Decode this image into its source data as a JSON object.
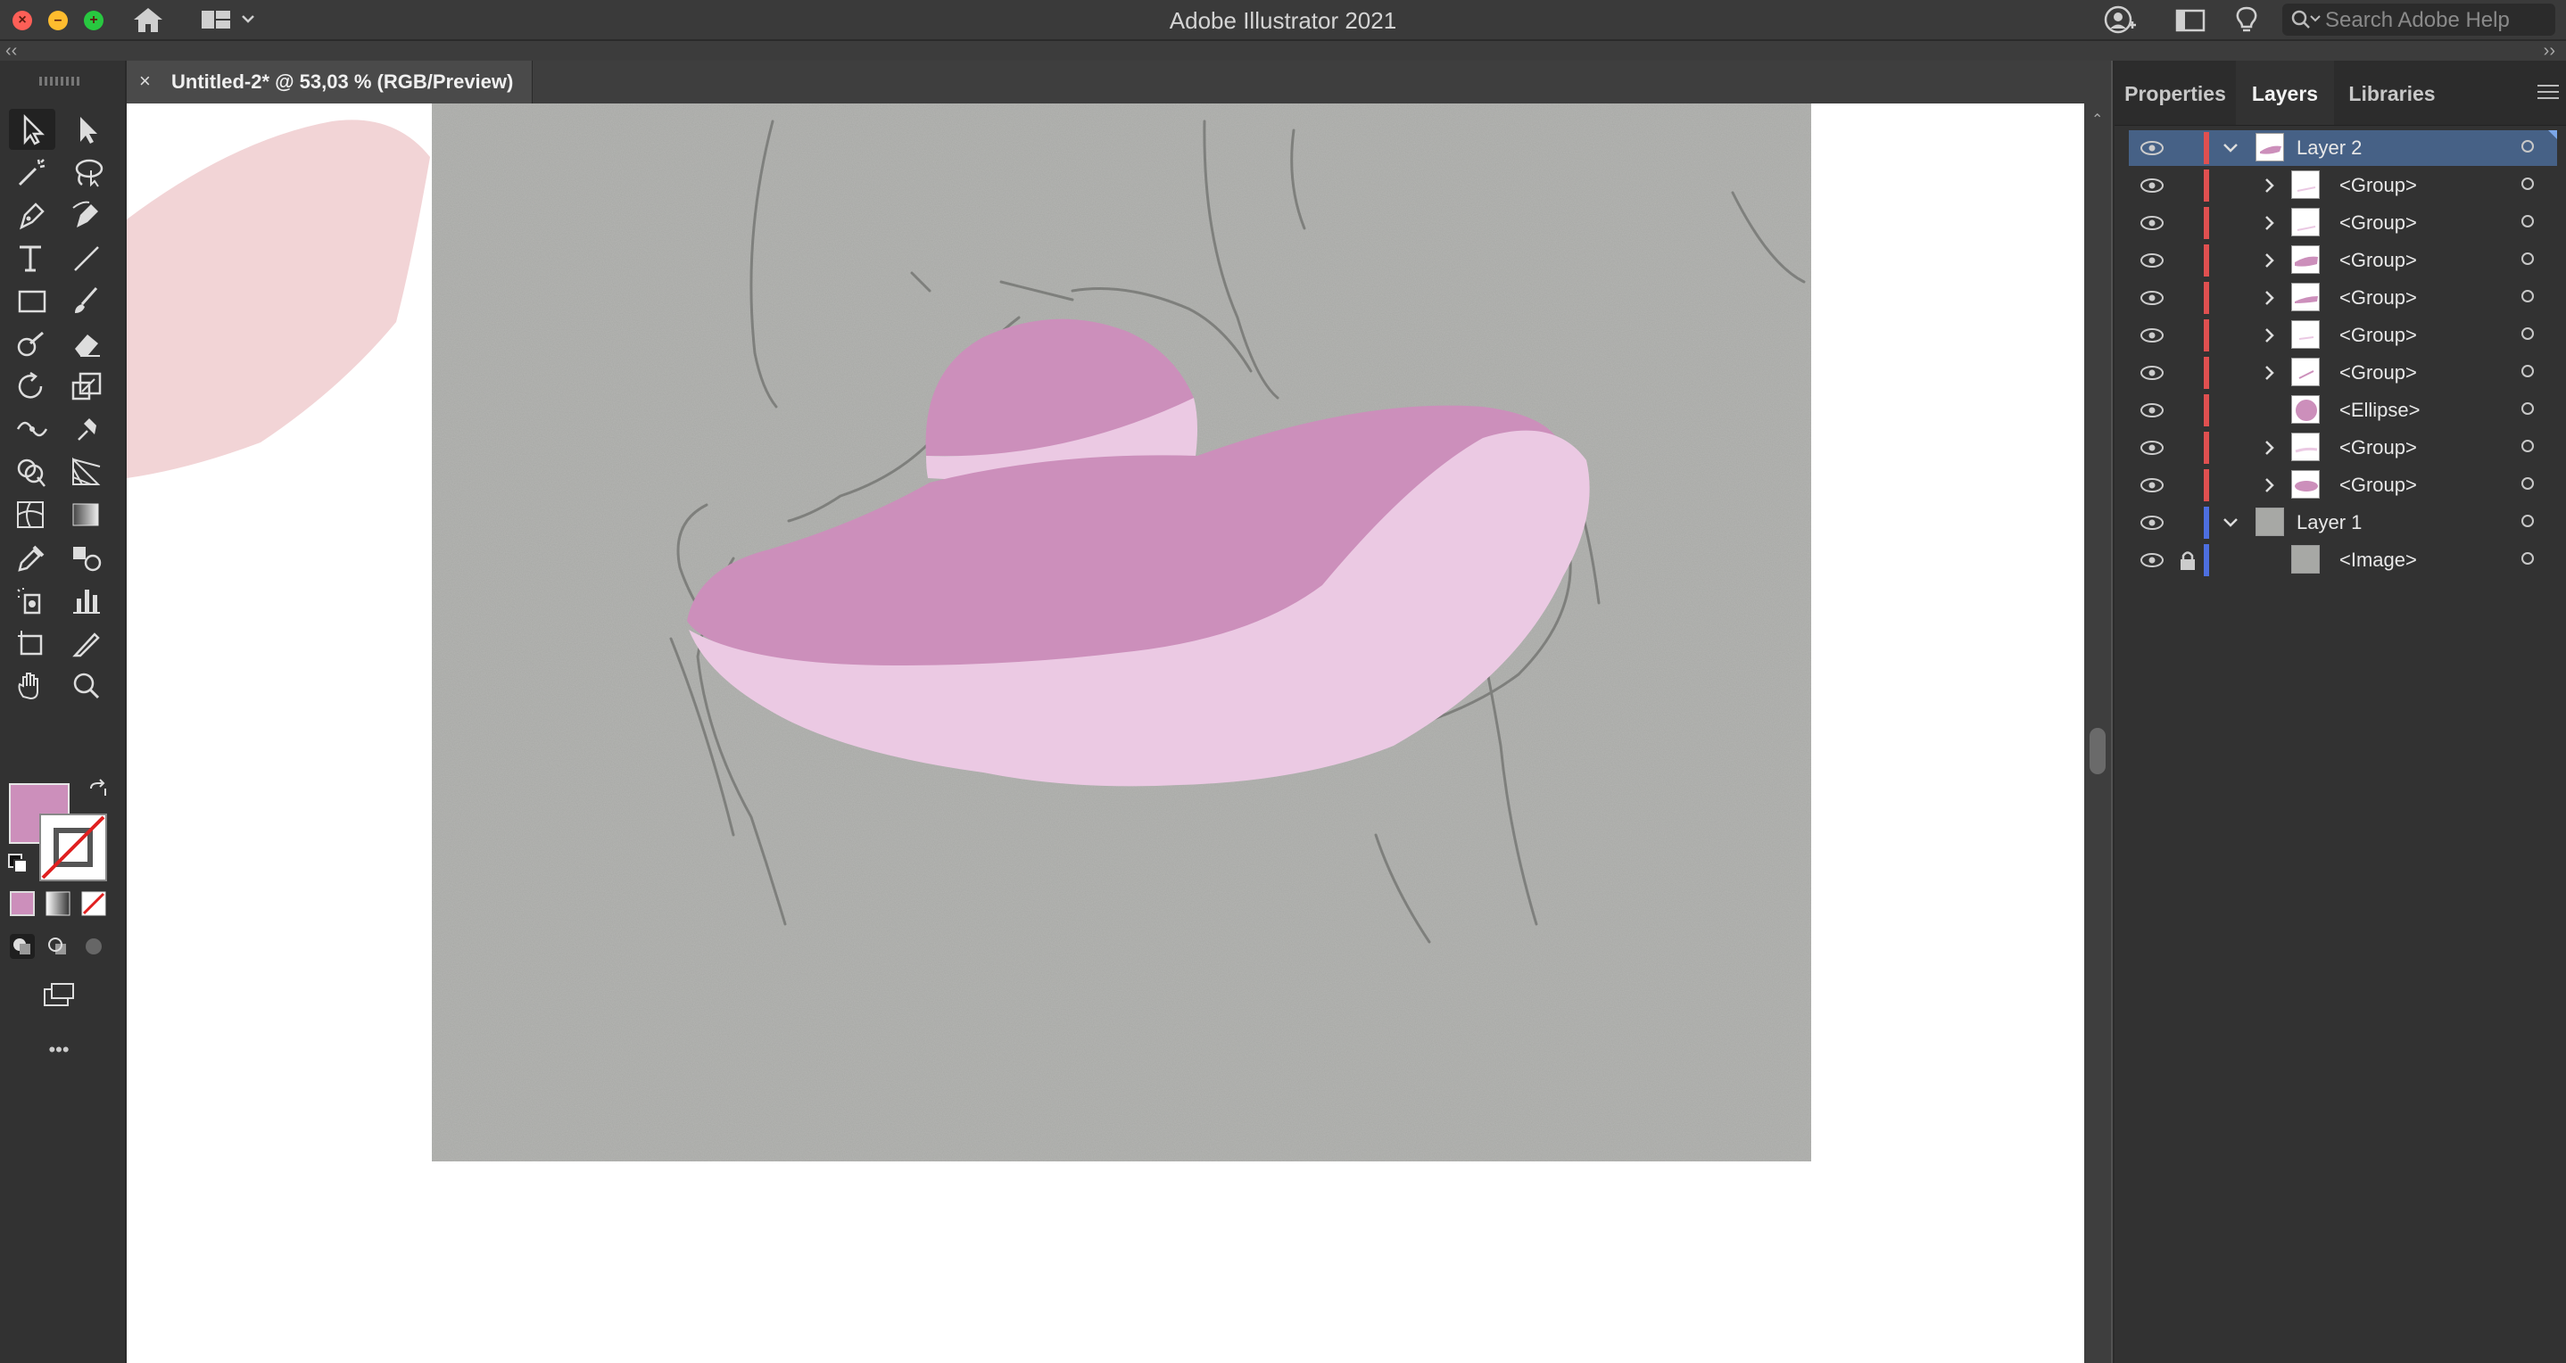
{
  "app": {
    "title": "Adobe Illustrator 2021",
    "help_search_placeholder": "Search Adobe Help"
  },
  "document": {
    "tab_title": "Untitled-2* @ 53,03 % (RGB/Preview)",
    "close_glyph": "×"
  },
  "toolbar": {
    "fill_color": "#cc8fbb",
    "stroke": "none",
    "more_glyph": "•••"
  },
  "panel": {
    "tabs": [
      {
        "label": "Properties"
      },
      {
        "label": "Layers"
      },
      {
        "label": "Libraries"
      }
    ],
    "active_tab": "Layers",
    "layers": [
      {
        "name": "Layer 2",
        "expanded": true,
        "selected": true
      },
      {
        "name": "<Group>"
      },
      {
        "name": "<Group>"
      },
      {
        "name": "<Group>"
      },
      {
        "name": "<Group>"
      },
      {
        "name": "<Group>"
      },
      {
        "name": "<Group>"
      },
      {
        "name": "<Ellipse>"
      },
      {
        "name": "<Group>"
      },
      {
        "name": "<Group>"
      },
      {
        "name": "Layer 1",
        "expanded": true
      },
      {
        "name": "<Image>",
        "locked": true
      }
    ]
  },
  "colors": {
    "hat_dark": "#cc8fbb",
    "hat_light": "#ebc9e3",
    "blob": "#f2d4d6",
    "layer2_color": "#e05050",
    "layer1_color": "#4d6fe0",
    "selection": "#466186"
  }
}
